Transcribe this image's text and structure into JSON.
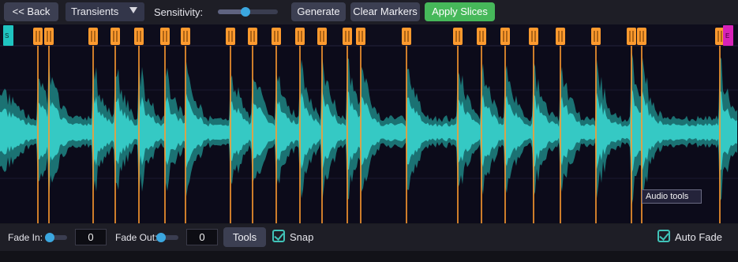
{
  "toolbar": {
    "back_label": "<< Back",
    "mode_value": "Transients",
    "sensitivity_label": "Sensitivity:",
    "sensitivity_value": 0.45,
    "generate_label": "Generate",
    "clear_label": "Clear Markers",
    "apply_label": "Apply Slices"
  },
  "waveform": {
    "start_marker": "S",
    "end_marker": "E",
    "wave_color": "#35c9c4",
    "marker_color": "#ff9a2e",
    "tooltip": "Audio tools"
  },
  "bottom": {
    "fade_in_label": "Fade In:",
    "fade_in_value": "0",
    "fade_out_label": "Fade Out:",
    "fade_out_value": "0",
    "tools_label": "Tools",
    "snap_label": "Snap",
    "snap_checked": true,
    "auto_fade_label": "Auto Fade",
    "auto_fade_checked": true
  },
  "colors": {
    "accent_green": "#46b85a",
    "slider_knob": "#3ba7e0"
  }
}
